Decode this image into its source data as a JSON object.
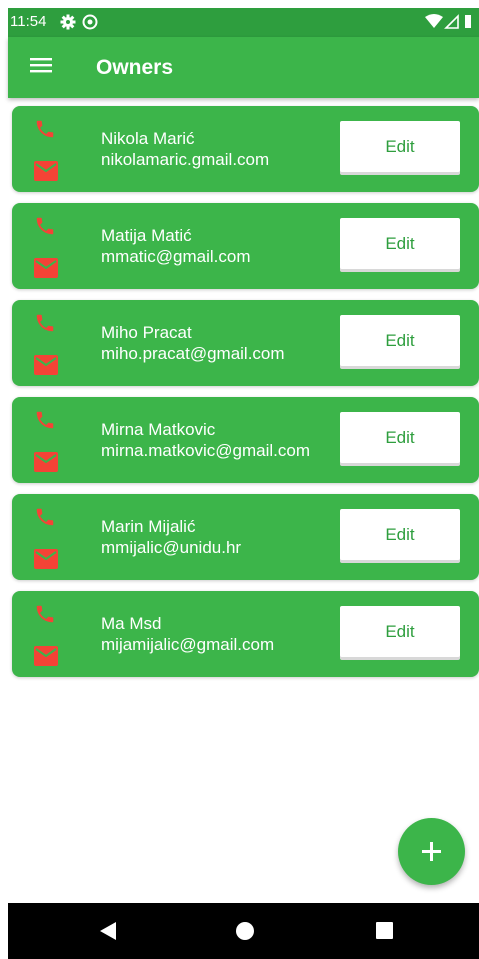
{
  "status_bar": {
    "time": "11:54"
  },
  "app_bar": {
    "title": "Owners"
  },
  "owners": [
    {
      "name": "Nikola Marić",
      "email": "nikolamaric.gmail.com",
      "edit_label": "Edit"
    },
    {
      "name": "Matija Matić",
      "email": "mmatic@gmail.com",
      "edit_label": "Edit"
    },
    {
      "name": "Miho Pracat",
      "email": "miho.pracat@gmail.com",
      "edit_label": "Edit"
    },
    {
      "name": "Mirna Matkovic",
      "email": "mirna.matkovic@gmail.com",
      "edit_label": "Edit"
    },
    {
      "name": "Marin Mijalić",
      "email": "mmijalic@unidu.hr",
      "edit_label": "Edit"
    },
    {
      "name": "Ma Msd",
      "email": "mijamijalic@gmail.com",
      "edit_label": "Edit"
    }
  ],
  "icons": {
    "menu": "menu-icon",
    "phone": "phone-icon",
    "mail": "mail-icon",
    "add": "add-icon",
    "back": "back-icon",
    "home": "home-icon",
    "recents": "recents-icon"
  },
  "colors": {
    "primary": "#3cb54a",
    "primary_dark": "#2e9e3e",
    "icon_accent": "#f44336"
  }
}
